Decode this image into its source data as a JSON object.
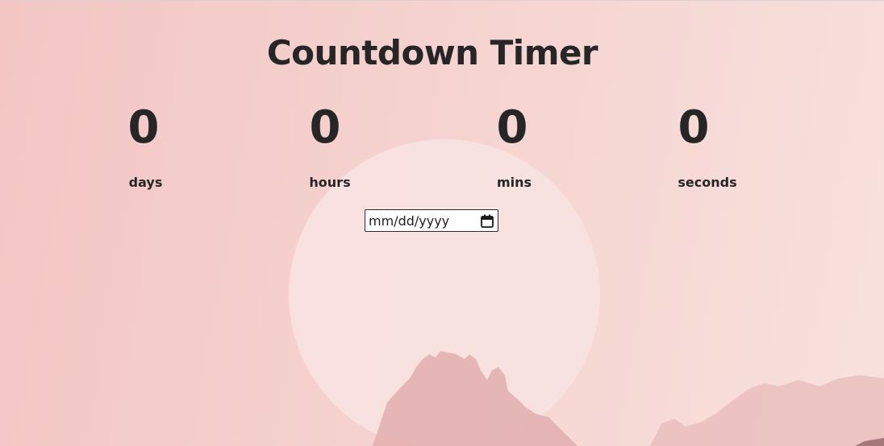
{
  "title": "Countdown Timer",
  "timer": {
    "days": {
      "value": "0",
      "label": "days"
    },
    "hours": {
      "value": "0",
      "label": "hours"
    },
    "mins": {
      "value": "0",
      "label": "mins"
    },
    "seconds": {
      "value": "0",
      "label": "seconds"
    }
  },
  "date_input": {
    "placeholder": "mm/dd/yyyy",
    "icon": "calendar-icon"
  },
  "colors": {
    "background": "#f5d2cf",
    "moon": "#f8e3e1",
    "mountains": "#e6b5b4",
    "text": "#262626"
  }
}
